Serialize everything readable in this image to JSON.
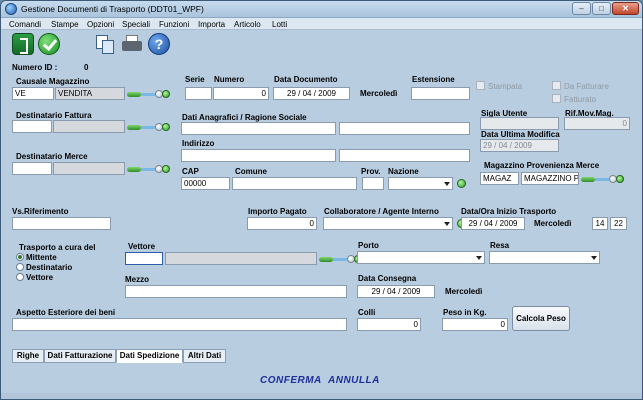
{
  "window": {
    "title": "Gestione Documenti di Trasporto (DDT01_WPF)"
  },
  "menu": [
    "Comandi",
    "Stampe",
    "Opzioni",
    "Speciali",
    "Funzioni",
    "Importa",
    "Articolo",
    "Lotti"
  ],
  "toolbar": {
    "icons": [
      "exit-icon",
      "confirm-icon",
      "copy-icon",
      "print-icon",
      "help-icon"
    ]
  },
  "header": {
    "numero_id_label": "Numero ID :",
    "numero_id_value": "0"
  },
  "labels": {
    "causale": "Causale Magazzino",
    "serie": "Serie",
    "numero": "Numero",
    "data_documento": "Data Documento",
    "estensione": "Estensione",
    "stampata": "Stampata",
    "da_fatturare": "Da Fatturare",
    "fatturato": "Fatturato",
    "sigla_utente": "Sigla Utente",
    "rif_mov_mag": "Rif.Mov.Mag.",
    "data_ultima_modifica": "Data Ultima Modifica",
    "destinatario_fattura": "Destinatario Fattura",
    "dati_anagrafici": "Dati Anagrafici / Ragione Sociale",
    "indirizzo": "Indirizzo",
    "destinatario_merce": "Destinatario Merce",
    "cap": "CAP",
    "comune": "Comune",
    "prov": "Prov.",
    "nazione": "Nazione",
    "magazzino_provenienza": "Magazzino Provenienza Merce",
    "vs_riferimento": "Vs.Riferimento",
    "importo_pagato": "Importo Pagato",
    "collaboratore": "Collaboratore / Agente Interno",
    "data_ora_inizio": "Data/Ora Inizio Trasporto",
    "trasporto_cura": "Trasporto a cura del",
    "vettore": "Vettore",
    "porto": "Porto",
    "resa": "Resa",
    "mezzo": "Mezzo",
    "data_consegna": "Data Consegna",
    "aspetto": "Aspetto Esteriore dei beni",
    "colli": "Colli",
    "peso": "Peso in Kg."
  },
  "values": {
    "causale_code": "VE",
    "causale_desc": "VENDITA",
    "numero": "0",
    "data_documento": "29 / 04 / 2009",
    "giorno_documento": "Mercoledì",
    "rif_mov_mag": "0",
    "data_ultima_modifica": "29 / 04 / 2009",
    "cap": "00000",
    "magazzino_code": "MAGAZ",
    "magazzino_desc": "MAGAZZINO P",
    "importo_pagato": "0",
    "data_inizio": "29 / 04 / 2009",
    "giorno_inizio": "Mercoledì",
    "ora": "14",
    "minuti": "22",
    "data_consegna": "29 / 04 / 2009",
    "giorno_consegna": "Mercoledì",
    "colli": "0",
    "peso": "0"
  },
  "trasporto_options": [
    {
      "label": "Mittente",
      "selected": true
    },
    {
      "label": "Destinatario",
      "selected": false
    },
    {
      "label": "Vettore",
      "selected": false
    }
  ],
  "buttons": {
    "calcola_peso": "Calcola Peso"
  },
  "tabs": [
    {
      "label": "Righe",
      "active": false
    },
    {
      "label": "Dati Fatturazione",
      "active": false
    },
    {
      "label": "Dati Spedizione",
      "active": true
    },
    {
      "label": "Altri Dati",
      "active": false
    }
  ],
  "actions": {
    "conferma": "CONFERMA",
    "annulla": "ANNULLA"
  }
}
